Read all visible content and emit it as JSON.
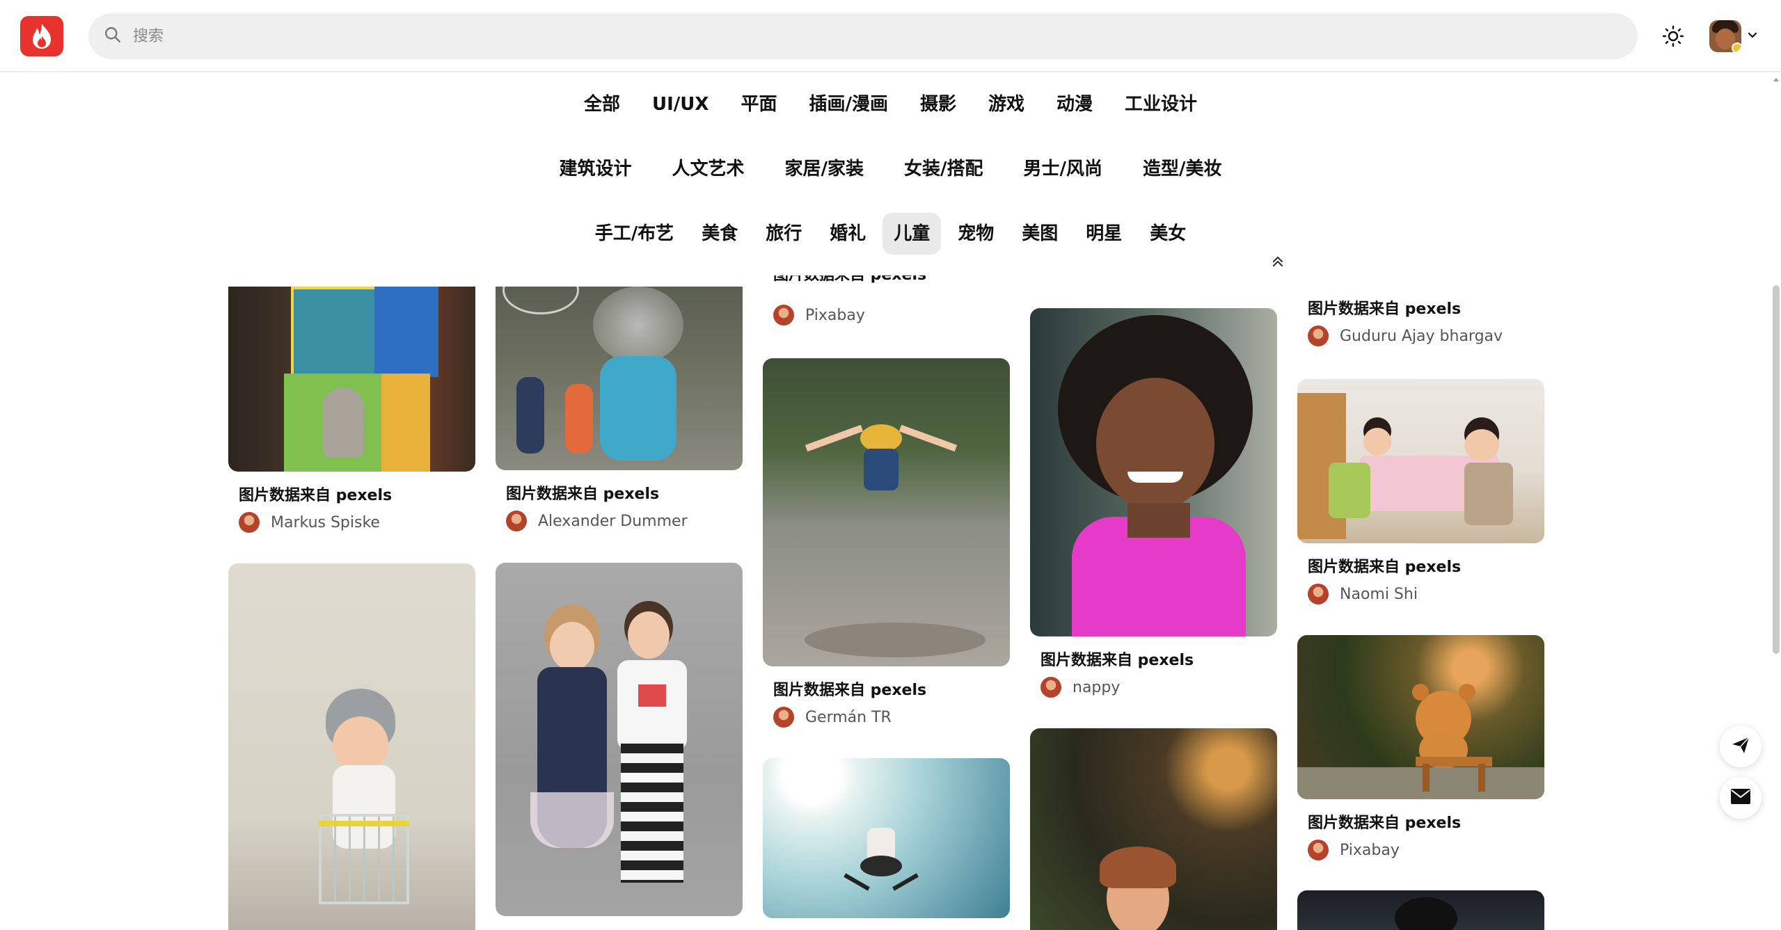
{
  "header": {
    "search_placeholder": "搜索"
  },
  "categories": {
    "row1": [
      "全部",
      "UI/UX",
      "平面",
      "插画/漫画",
      "摄影",
      "游戏",
      "动漫",
      "工业设计"
    ],
    "row2": [
      "建筑设计",
      "人文艺术",
      "家居/家装",
      "女装/搭配",
      "男士/风尚",
      "造型/美妆"
    ],
    "row3": [
      "手工/布艺",
      "美食",
      "旅行",
      "婚礼",
      "儿童",
      "宠物",
      "美图",
      "明星",
      "美女"
    ],
    "active": "儿童"
  },
  "cards": {
    "c1": {
      "caption": "图片数据来自 pexels",
      "author": "Markus Spiske"
    },
    "c2": {
      "caption": "图片数据来自 pexels",
      "author": "Alexander Dummer"
    },
    "c3": {
      "caption": "图片数据来自 pexels",
      "author": "Pixabay"
    },
    "c4": {
      "caption": "图片数据来自 pexels",
      "author": "nappy"
    },
    "c5": {
      "caption": "图片数据来自 pexels",
      "author": "Guduru Ajay bhargav"
    },
    "c6": {
      "caption": "图片数据来自 pexels",
      "author": "Naomi Shi"
    },
    "c7": {
      "caption": "图片数据来自 pexels",
      "author": "Germán TR"
    },
    "c8": {
      "caption": "图片数据来自 pexels",
      "author": "Pixabay"
    }
  },
  "icons": {
    "logo": "flame-icon",
    "search": "search-icon",
    "theme": "sun-icon",
    "collapse": "chevrons-up-icon",
    "send": "paper-plane-icon",
    "mail": "envelope-icon"
  },
  "colors": {
    "brand": "#e8322d",
    "active_category_bg": "#e9e9e9"
  }
}
